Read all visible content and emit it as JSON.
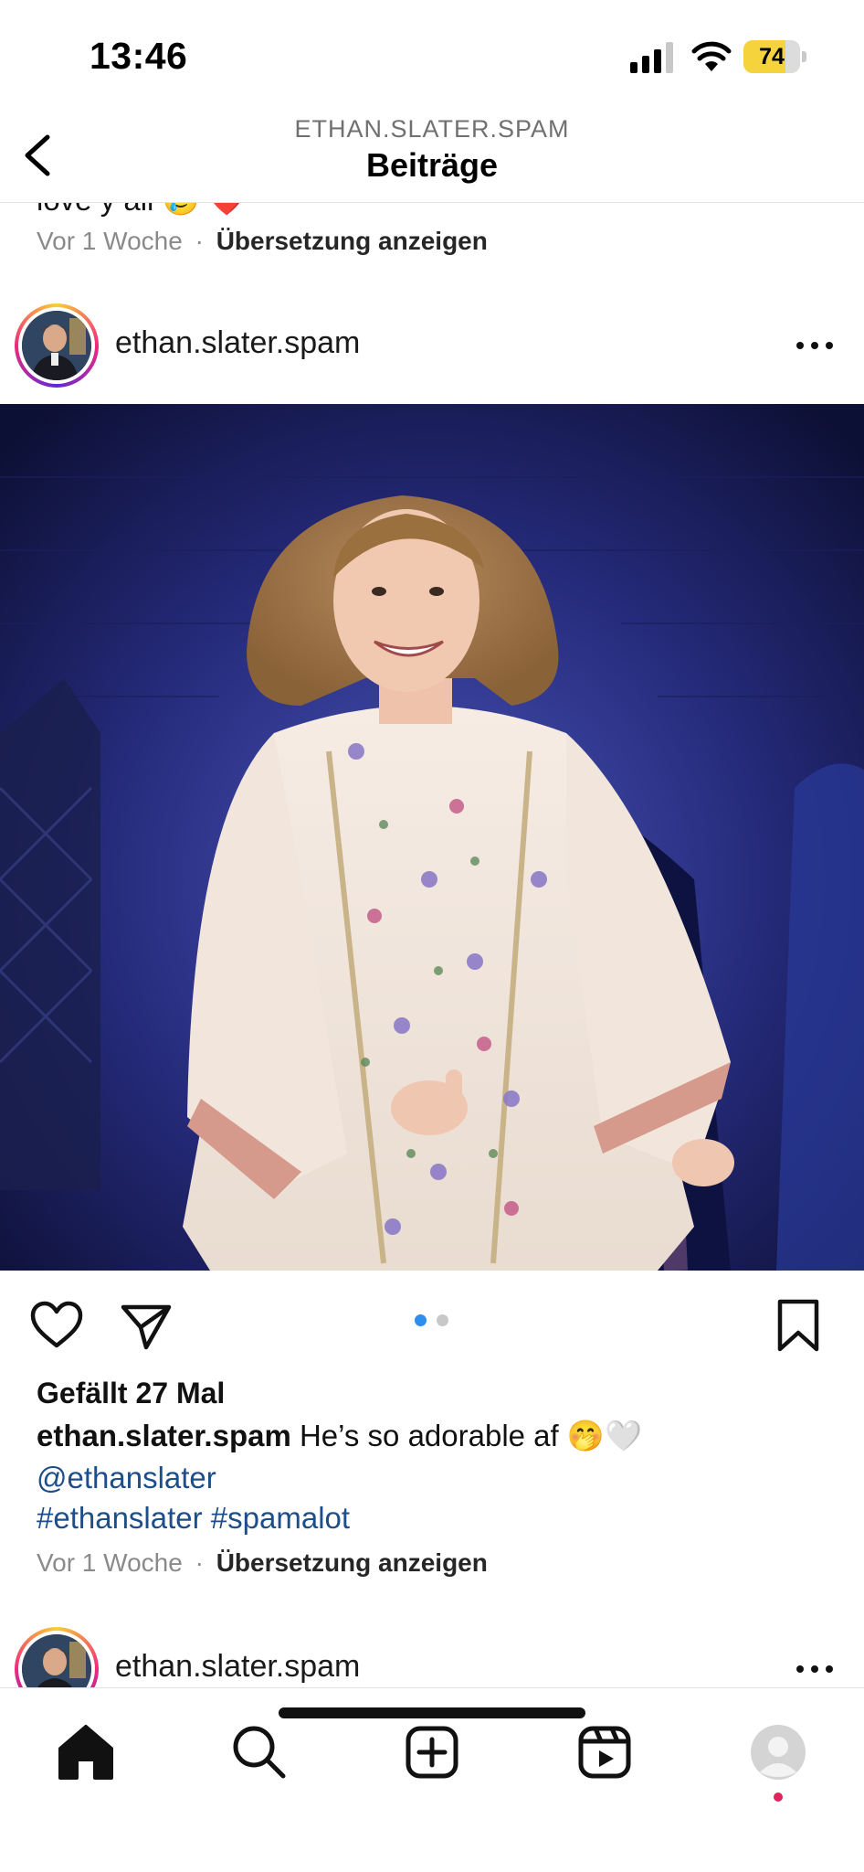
{
  "status": {
    "time": "13:46",
    "battery": "74",
    "battery_level": 0.74
  },
  "nav": {
    "subtitle": "ETHAN.SLATER.SPAM",
    "title": "Beiträge"
  },
  "prev_post": {
    "caption_tail": "love y all 🥲 ❤️",
    "time": "Vor 1 Woche",
    "separator": "·",
    "translate": "Übersetzung anzeigen"
  },
  "post": {
    "username": "ethan.slater.spam",
    "image_alt": "",
    "carousel_count": 2,
    "carousel_active": 0,
    "likes": "Gefällt 27 Mal",
    "caption_user": "ethan.slater.spam",
    "caption_text": "He’s so adorable af 🤭🤍",
    "mention": "@ethanslater",
    "hashtags": "#ethanslater #spamalot",
    "time": "Vor 1 Woche",
    "separator": "·",
    "translate": "Übersetzung anzeigen"
  },
  "next_post": {
    "username": "ethan.slater.spam"
  },
  "colors": {
    "link": "#1d4e89",
    "carousel_active": "#2b8ef0",
    "carousel_inactive": "#c8c8c8",
    "notification_dot": "#e0245e"
  },
  "icons": {
    "back": "chevron-left-icon",
    "more": "ellipsis-icon",
    "like": "heart-icon",
    "share": "send-icon",
    "save": "bookmark-icon",
    "home": "home-icon",
    "search": "search-icon",
    "create": "plus-square-icon",
    "reels": "reels-icon",
    "profile": "profile-icon"
  }
}
